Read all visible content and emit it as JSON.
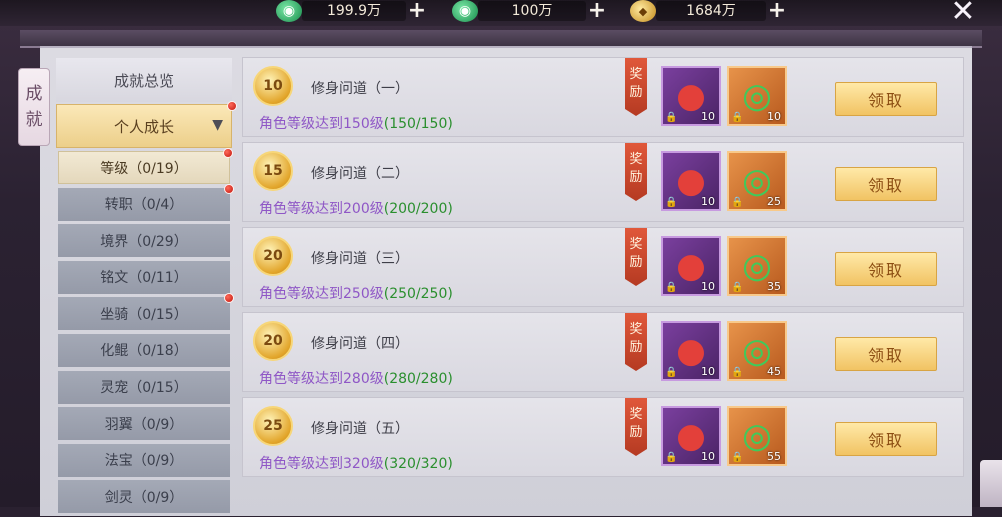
{
  "currencies": [
    {
      "icon": "jade-icon",
      "value": "199.9万"
    },
    {
      "icon": "bound-jade-icon",
      "value": "100万"
    },
    {
      "icon": "gold-coin-icon",
      "value": "1684万"
    }
  ],
  "side_tag": {
    "chars": [
      "成",
      "就"
    ]
  },
  "menu": {
    "overview_label": "成就总览",
    "personal_label": "个人成长",
    "sub_items": [
      {
        "label": "等级（0/19）",
        "dot": true,
        "active": true
      },
      {
        "label": "转职（0/4）",
        "dot": true,
        "active": false
      },
      {
        "label": "境界（0/29）",
        "dot": false,
        "active": false
      },
      {
        "label": "铭文（0/11）",
        "dot": false,
        "active": false
      },
      {
        "label": "坐骑（0/15）",
        "dot": true,
        "active": false
      },
      {
        "label": "化鲲（0/18）",
        "dot": false,
        "active": false
      },
      {
        "label": "灵宠（0/15）",
        "dot": false,
        "active": false
      },
      {
        "label": "羽翼（0/9）",
        "dot": false,
        "active": false
      },
      {
        "label": "法宝（0/9）",
        "dot": false,
        "active": false
      },
      {
        "label": "剑灵（0/9）",
        "dot": false,
        "active": false
      }
    ]
  },
  "reward_label": [
    "奖",
    "励"
  ],
  "claim_label": "领取",
  "achievements": [
    {
      "medal": "10",
      "title": "修身问道（一）",
      "desc": "角色等级达到150级",
      "progress": "(150/150)",
      "rewards": [
        "10",
        "10"
      ]
    },
    {
      "medal": "15",
      "title": "修身问道（二）",
      "desc": "角色等级达到200级",
      "progress": "(200/200)",
      "rewards": [
        "10",
        "25"
      ]
    },
    {
      "medal": "20",
      "title": "修身问道（三）",
      "desc": "角色等级达到250级",
      "progress": "(250/250)",
      "rewards": [
        "10",
        "35"
      ]
    },
    {
      "medal": "20",
      "title": "修身问道（四）",
      "desc": "角色等级达到280级",
      "progress": "(280/280)",
      "rewards": [
        "10",
        "45"
      ]
    },
    {
      "medal": "25",
      "title": "修身问道（五）",
      "desc": "角色等级达到320级",
      "progress": "(320/320)",
      "rewards": [
        "10",
        "55"
      ]
    }
  ]
}
